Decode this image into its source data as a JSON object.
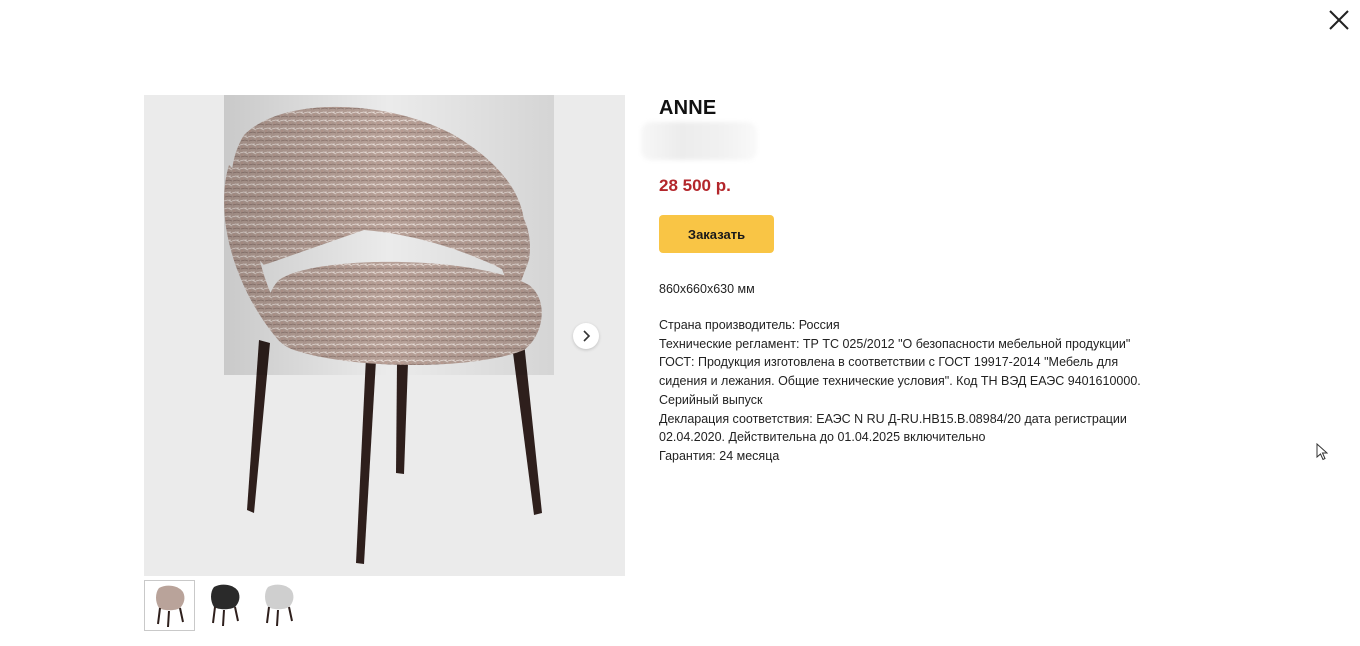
{
  "modal": {
    "close_label": "×"
  },
  "product": {
    "title": "ANNE",
    "price": "28 500 р.",
    "order_button": "Заказать",
    "dimensions": "860х660х630 мм",
    "specs": [
      "Страна производитель: Россия",
      "Технические регламент: ТР ТС 025/2012 \"О безопасности мебельной продукции\"",
      "ГОСТ: Продукция изготовлена в соответствии с ГОСТ 19917-2014 \"Мебель для сидения и лежания. Общие технические условия\". Код ТН ВЭД ЕАЭС 9401610000. Серийный выпуск",
      "Декларация соответствия: ЕАЭС N RU Д-RU.НВ15.В.08984/20 дата регистрации 02.04.2020. Действительна до 01.04.2025 включительно",
      "Гарантия: 24 месяца"
    ]
  },
  "gallery": {
    "thumbnails": [
      {
        "variant": "beige-tweed",
        "active": true
      },
      {
        "variant": "black",
        "active": false
      },
      {
        "variant": "light-grey",
        "active": false
      }
    ]
  },
  "colors": {
    "price": "#b3262b",
    "order_button": "#f9c545",
    "gallery_bg": "#ebebeb",
    "fabric": "#b9a39a",
    "legs": "#2e1f1c"
  },
  "icons": {
    "close": "close-icon",
    "next": "chevron-right-icon",
    "cursor": "mouse-pointer-icon"
  }
}
